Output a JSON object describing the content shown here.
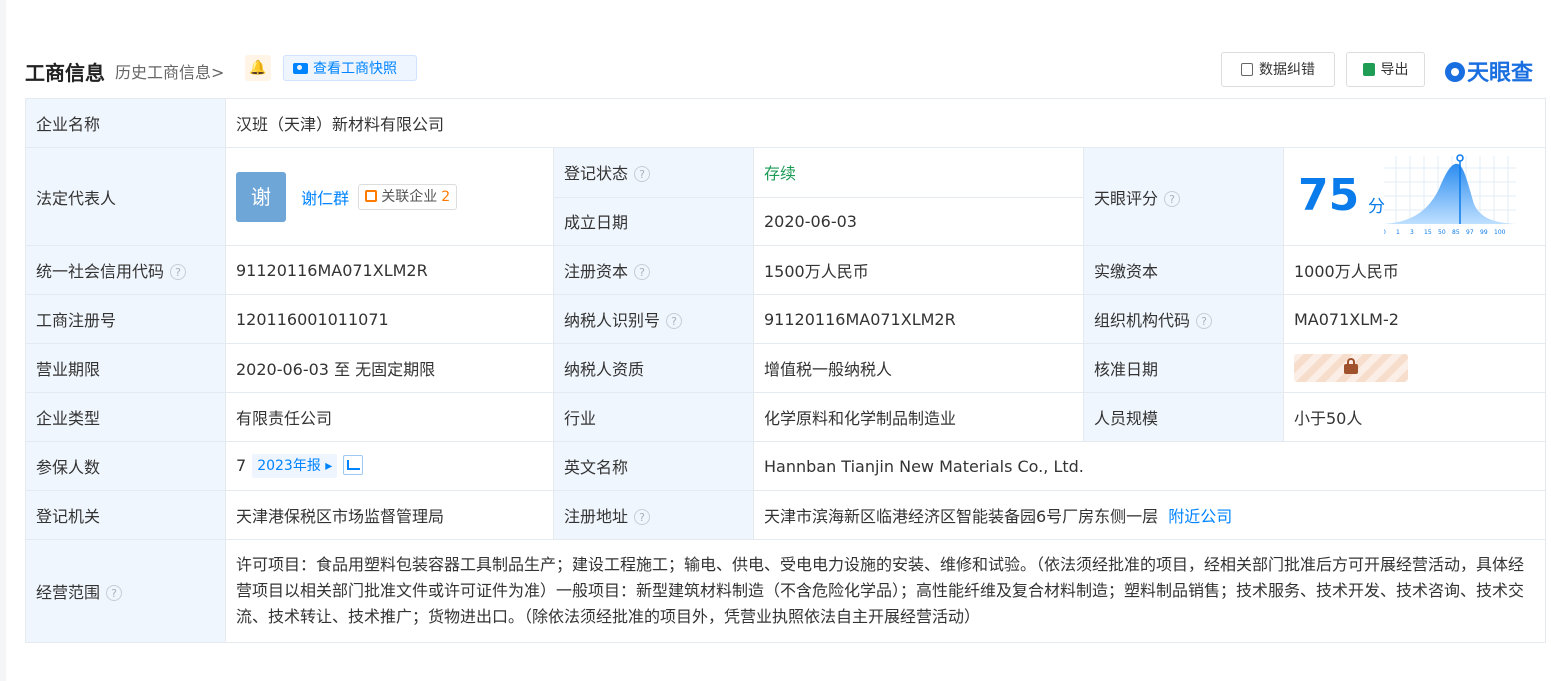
{
  "header": {
    "title": "工商信息",
    "history_link": "历史工商信息>",
    "snapshot_button": "查看工商快照",
    "correct_button": "数据纠错",
    "export_button": "导出",
    "brand": "天眼查"
  },
  "company": {
    "name_label": "企业名称",
    "name": "汉班（天津）新材料有限公司",
    "legal_rep_label": "法定代表人",
    "legal_rep_avatar": "谢",
    "legal_rep": "谢仁群",
    "related_label": "关联企业",
    "related_count": "2",
    "status_label": "登记状态",
    "status": "存续",
    "founded_label": "成立日期",
    "founded": "2020-06-03",
    "score_label": "天眼评分",
    "score": "75",
    "score_unit": "分",
    "score_axis": [
      "0",
      "1",
      "3",
      "15",
      "50",
      "85",
      "97",
      "99",
      "100"
    ],
    "credit_code_label": "统一社会信用代码",
    "credit_code": "91120116MA071XLM2R",
    "reg_capital_label": "注册资本",
    "reg_capital": "1500万人民币",
    "paid_capital_label": "实缴资本",
    "paid_capital": "1000万人民币",
    "reg_no_label": "工商注册号",
    "reg_no": "120116001011071",
    "taxpayer_id_label": "纳税人识别号",
    "taxpayer_id": "91120116MA071XLM2R",
    "org_code_label": "组织机构代码",
    "org_code": "MA071XLM-2",
    "term_label": "营业期限",
    "term": "2020-06-03 至 无固定期限",
    "tax_qual_label": "纳税人资质",
    "tax_qual": "增值税一般纳税人",
    "approval_date_label": "核准日期",
    "type_label": "企业类型",
    "type": "有限责任公司",
    "industry_label": "行业",
    "industry": "化学原料和化学制品制造业",
    "staff_size_label": "人员规模",
    "staff_size": "小于50人",
    "insured_label": "参保人数",
    "insured": "7",
    "insured_report": "2023年报",
    "english_name_label": "英文名称",
    "english_name": "Hannban Tianjin New Materials Co., Ltd.",
    "authority_label": "登记机关",
    "authority": "天津港保税区市场监督管理局",
    "address_label": "注册地址",
    "address": "天津市滨海新区临港经济区智能装备园6号厂房东侧一层",
    "nearby_link": "附近公司",
    "scope_label": "经营范围",
    "scope": "许可项目：食品用塑料包装容器工具制品生产；建设工程施工；输电、供电、受电电力设施的安装、维修和试验。（依法须经批准的项目，经相关部门批准后方可开展经营活动，具体经营项目以相关部门批准文件或许可证件为准）一般项目：新型建筑材料制造（不含危险化学品）；高性能纤维及复合材料制造；塑料制品销售；技术服务、技术开发、技术咨询、技术交流、技术转让、技术推广；货物进出口。（除依法须经批准的项目外，凭营业执照依法自主开展经营活动）"
  }
}
